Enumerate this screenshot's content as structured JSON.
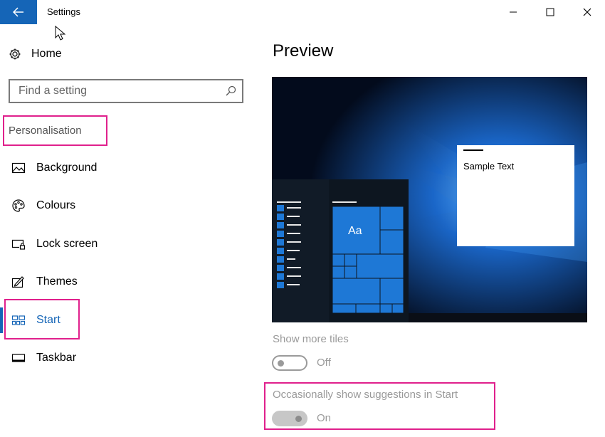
{
  "window": {
    "title": "Settings",
    "controls": {
      "minimize": "minimize-icon",
      "maximize": "maximize-icon",
      "close": "close-icon"
    }
  },
  "sidebar": {
    "home_label": "Home",
    "search_placeholder": "Find a setting",
    "section_header": "Personalisation",
    "items": [
      {
        "label": "Background",
        "icon": "image-icon"
      },
      {
        "label": "Colours",
        "icon": "palette-icon"
      },
      {
        "label": "Lock screen",
        "icon": "lock-screen-icon"
      },
      {
        "label": "Themes",
        "icon": "themes-icon"
      },
      {
        "label": "Start",
        "icon": "start-tiles-icon",
        "active": true
      },
      {
        "label": "Taskbar",
        "icon": "taskbar-icon"
      }
    ]
  },
  "main": {
    "preview_title": "Preview",
    "preview": {
      "sample_text": "Sample Text",
      "tile_label": "Aa"
    },
    "options": [
      {
        "label": "Show more tiles",
        "state": "Off",
        "on": false
      },
      {
        "label": "Occasionally show suggestions in Start",
        "state": "On",
        "on": true
      }
    ]
  },
  "colors": {
    "accent": "#1565b7",
    "highlight": "#e0208c",
    "disabled_text": "#9a9a9a"
  }
}
